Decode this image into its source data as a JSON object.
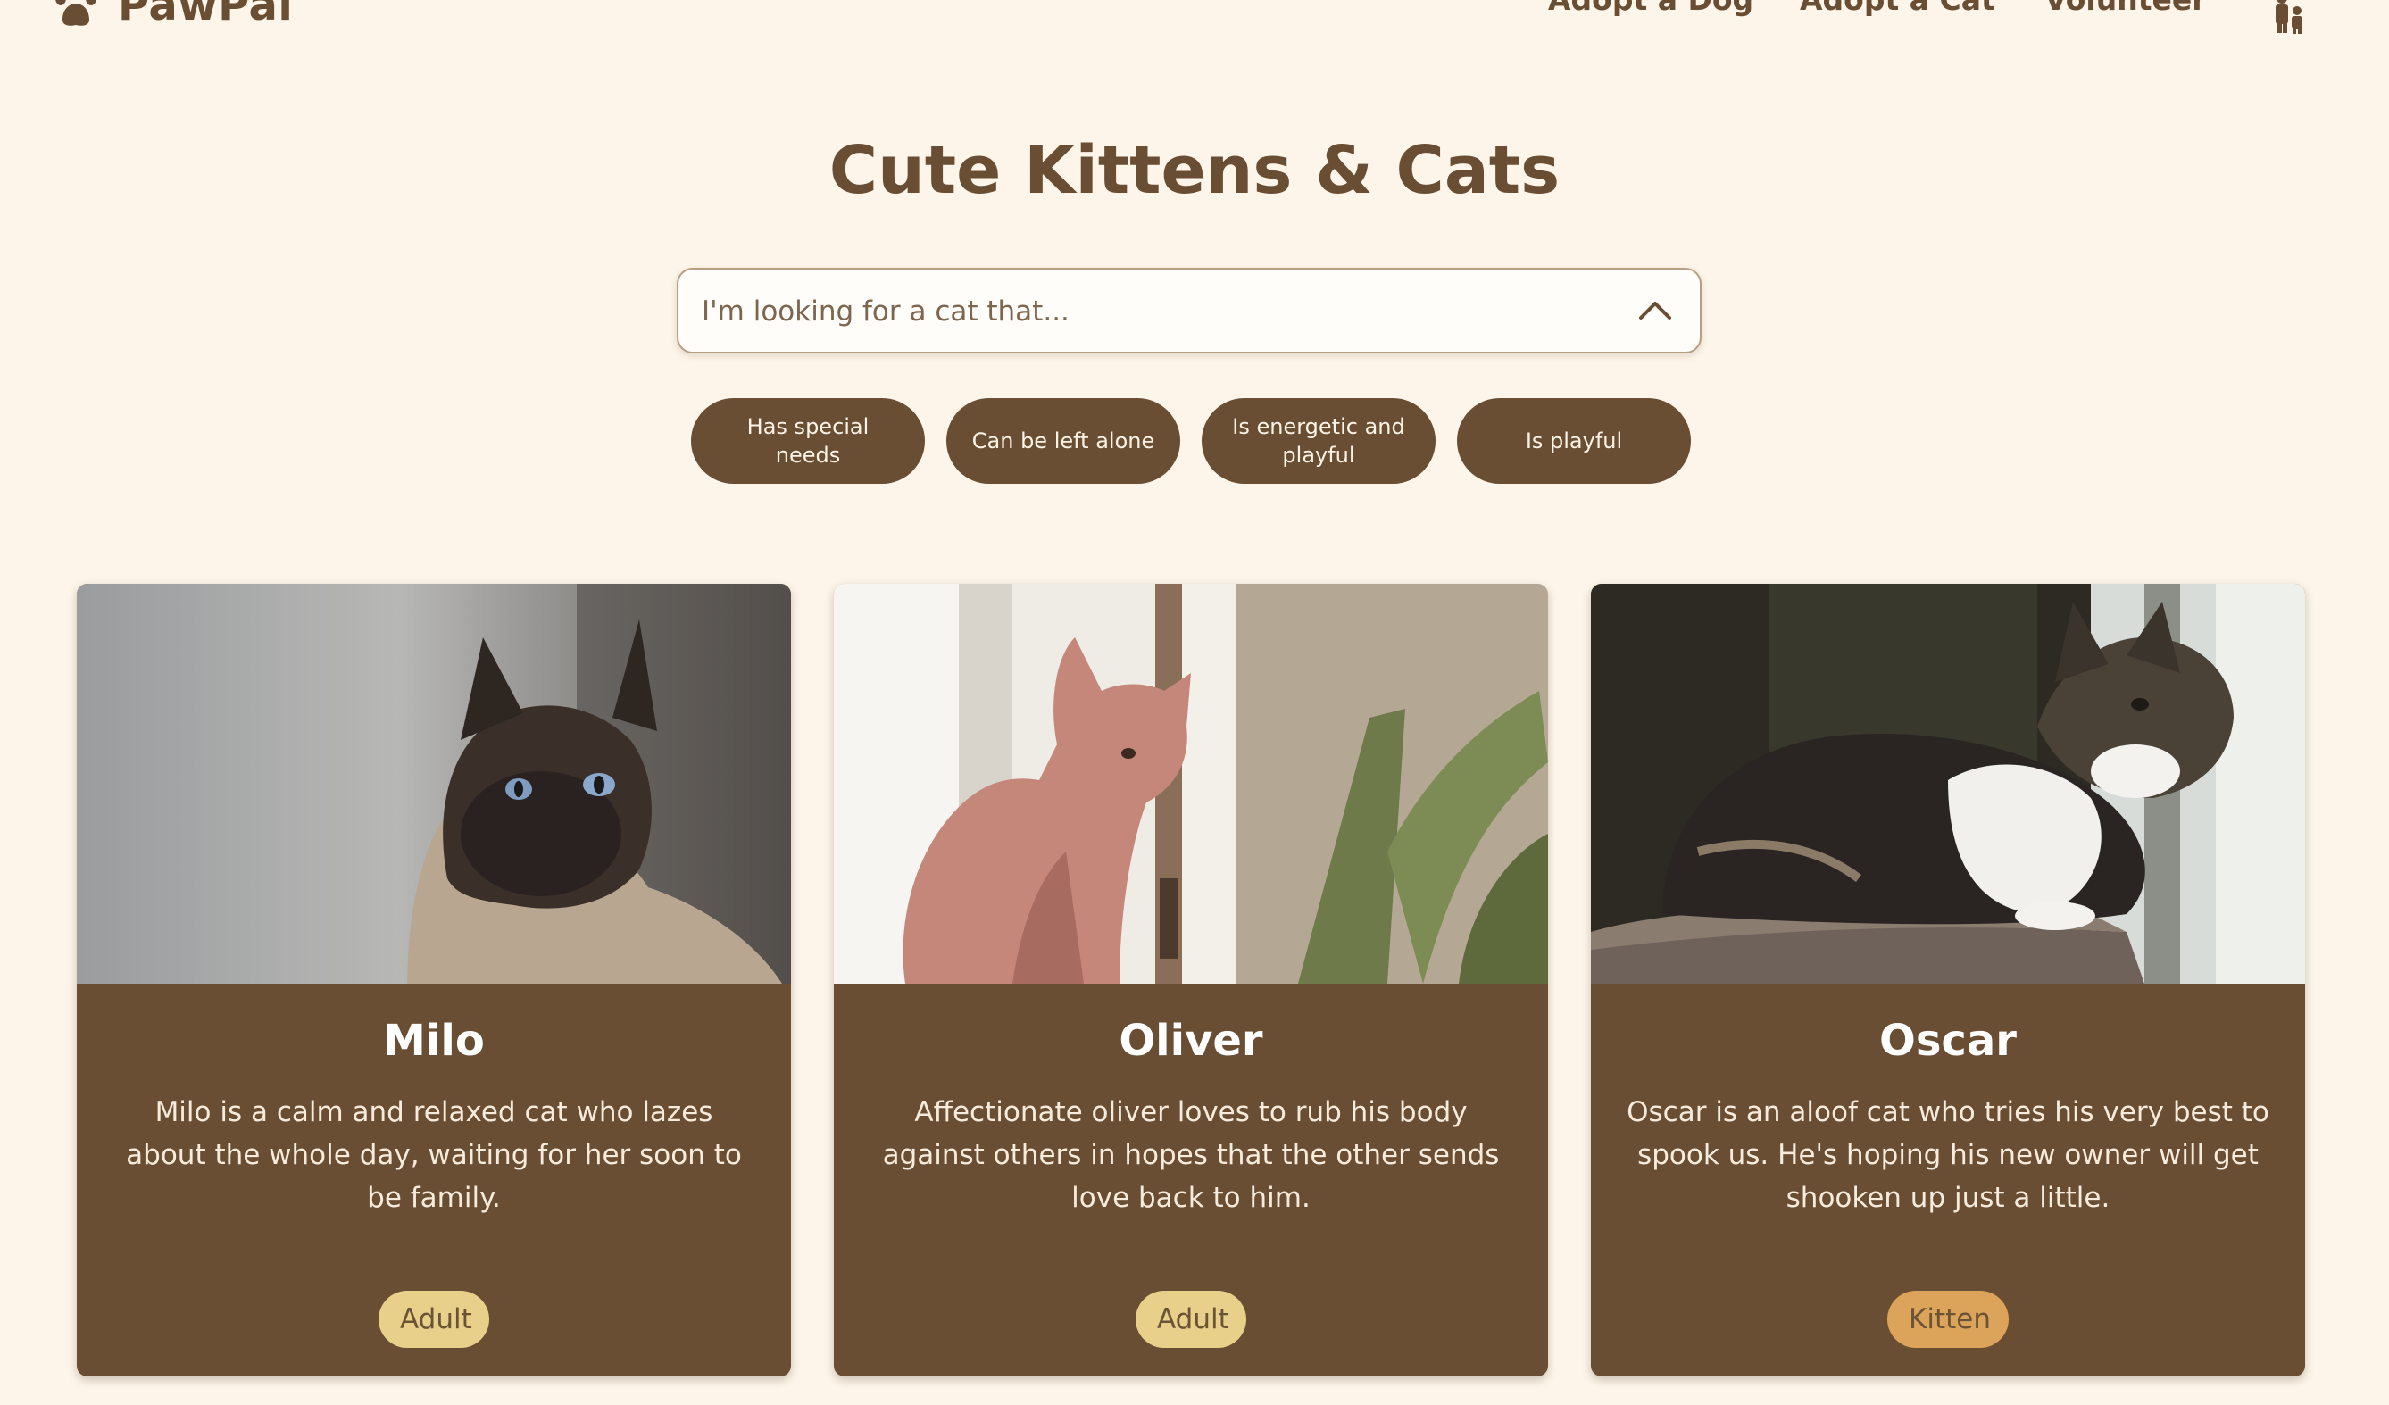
{
  "nav": {
    "brand": "PawPal",
    "brand_icon": "paw-icon",
    "links": [
      "Adopt a Dog",
      "Adopt a Cat",
      "Volunteer"
    ],
    "extra_icon": "volunteer-people-icon"
  },
  "page": {
    "title": "Cute Kittens & Cats"
  },
  "search": {
    "placeholder": "I'm looking for a cat that...",
    "toggle_icon": "chevron-up-icon"
  },
  "filters": [
    "Has special needs",
    "Can be left alone",
    "Is energetic and playful",
    "Is playful"
  ],
  "cats": [
    {
      "name": "Milo",
      "description": "Milo is a calm and relaxed cat who lazes about the whole day, waiting for her soon to be family.",
      "age": "Adult",
      "badge_color": "#e8d08a"
    },
    {
      "name": "Oliver",
      "description": "Affectionate oliver loves to rub his body against others in hopes that the other sends love back to him.",
      "age": "Adult",
      "badge_color": "#e8d08a"
    },
    {
      "name": "Oscar",
      "description": "Oscar is an aloof cat who tries his very best to spook us. He's hoping his new owner will get shooken up just a little.",
      "age": "Kitten",
      "badge_color": "#dca35a"
    }
  ],
  "colors": {
    "background": "#fdf5e9",
    "primary": "#694e33",
    "card_text": "#ffffff"
  }
}
